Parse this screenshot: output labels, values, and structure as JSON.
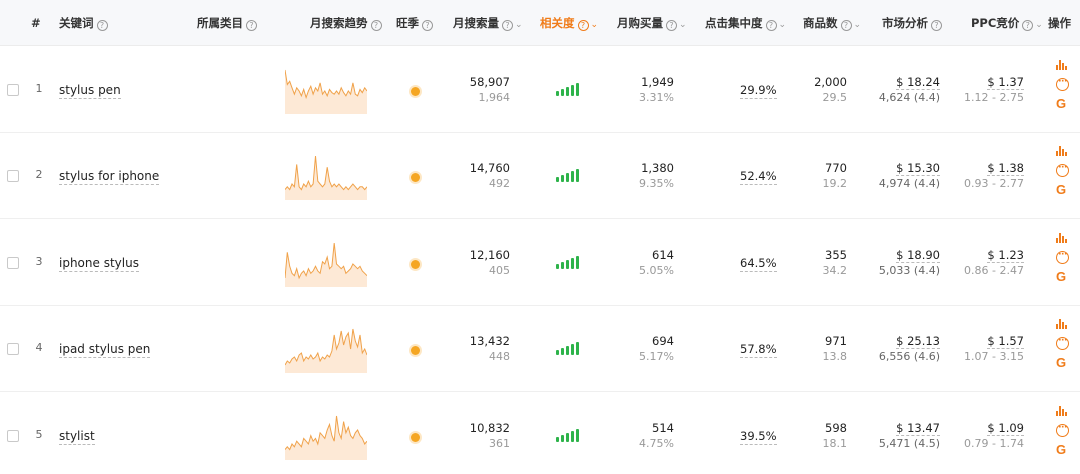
{
  "header": {
    "index": "#",
    "keyword": "关键词",
    "category": "所属类目",
    "trend": "月搜索趋势",
    "season": "旺季",
    "search_volume": "月搜索量",
    "relevance": "相关度",
    "purchases": "月购买量",
    "click_concentration": "点击集中度",
    "product_count": "商品数",
    "market": "市场分析",
    "ppc": "PPC竞价",
    "actions": "操作"
  },
  "colors": {
    "accent": "#f07c1a",
    "relevance_bar": "#2db34a",
    "sparkline": "#f0a24a",
    "season_dot": "#f5a623"
  },
  "rows": [
    {
      "index": "1",
      "keyword": "stylus pen",
      "search": "58,907",
      "search_sub": "1,964",
      "purchase": "1,949",
      "purchase_rate": "3.31%",
      "click": "29.9%",
      "products": "2,000",
      "products_sub": "29.5",
      "price": "$ 18.24",
      "rating": "4,624 (4.4)",
      "ppc": "$ 1.37",
      "ppc_range": "1.12 - 2.75",
      "relevance_level": 5,
      "trend": [
        52,
        34,
        38,
        30,
        22,
        30,
        26,
        20,
        28,
        18,
        26,
        32,
        22,
        30,
        26,
        36,
        22,
        26,
        20,
        28,
        24,
        22,
        26,
        22,
        30,
        24,
        20,
        26,
        22,
        36,
        22,
        20,
        28,
        24,
        30,
        26
      ]
    },
    {
      "index": "2",
      "keyword": "stylus for iphone",
      "search": "14,760",
      "search_sub": "492",
      "purchase": "1,380",
      "purchase_rate": "9.35%",
      "click": "52.4%",
      "products": "770",
      "products_sub": "19.2",
      "price": "$ 15.30",
      "rating": "4,974 (4.4)",
      "ppc": "$ 1.38",
      "ppc_range": "0.93 - 2.77",
      "relevance_level": 5,
      "trend": [
        6,
        8,
        6,
        10,
        8,
        24,
        8,
        6,
        10,
        8,
        12,
        8,
        10,
        30,
        12,
        10,
        8,
        10,
        22,
        12,
        8,
        10,
        8,
        10,
        8,
        6,
        8,
        6,
        8,
        10,
        8,
        6,
        8,
        8,
        6,
        8
      ]
    },
    {
      "index": "3",
      "keyword": "iphone stylus",
      "search": "12,160",
      "search_sub": "405",
      "purchase": "614",
      "purchase_rate": "5.05%",
      "click": "64.5%",
      "products": "355",
      "products_sub": "34.2",
      "price": "$ 18.90",
      "rating": "5,033 (4.4)",
      "ppc": "$ 1.23",
      "ppc_range": "0.86 - 2.47",
      "relevance_level": 5,
      "trend": [
        6,
        28,
        16,
        10,
        8,
        14,
        6,
        10,
        12,
        8,
        14,
        10,
        12,
        16,
        12,
        10,
        20,
        18,
        24,
        14,
        16,
        36,
        18,
        16,
        14,
        16,
        10,
        12,
        14,
        18,
        16,
        14,
        16,
        12,
        10,
        8
      ]
    },
    {
      "index": "4",
      "keyword": "ipad stylus pen",
      "search": "13,432",
      "search_sub": "448",
      "purchase": "694",
      "purchase_rate": "5.17%",
      "click": "57.8%",
      "products": "971",
      "products_sub": "13.8",
      "price": "$ 25.13",
      "rating": "6,556 (4.6)",
      "ppc": "$ 1.57",
      "ppc_range": "1.07 - 3.15",
      "relevance_level": 5,
      "trend": [
        6,
        10,
        8,
        12,
        14,
        10,
        16,
        18,
        10,
        14,
        12,
        16,
        12,
        14,
        18,
        10,
        14,
        12,
        16,
        14,
        20,
        36,
        22,
        28,
        40,
        26,
        34,
        38,
        22,
        42,
        30,
        24,
        36,
        18,
        22,
        16
      ]
    },
    {
      "index": "5",
      "keyword": "stylist",
      "search": "10,832",
      "search_sub": "361",
      "purchase": "514",
      "purchase_rate": "4.75%",
      "click": "39.5%",
      "products": "598",
      "products_sub": "18.1",
      "price": "$ 13.47",
      "rating": "5,471 (4.5)",
      "ppc": "$ 1.09",
      "ppc_range": "0.79 - 1.74",
      "relevance_level": 5,
      "trend": [
        6,
        8,
        6,
        10,
        8,
        12,
        10,
        8,
        14,
        12,
        10,
        16,
        12,
        14,
        10,
        18,
        16,
        14,
        20,
        24,
        16,
        12,
        30,
        18,
        14,
        26,
        18,
        22,
        16,
        14,
        18,
        20,
        16,
        14,
        10,
        12
      ]
    }
  ]
}
